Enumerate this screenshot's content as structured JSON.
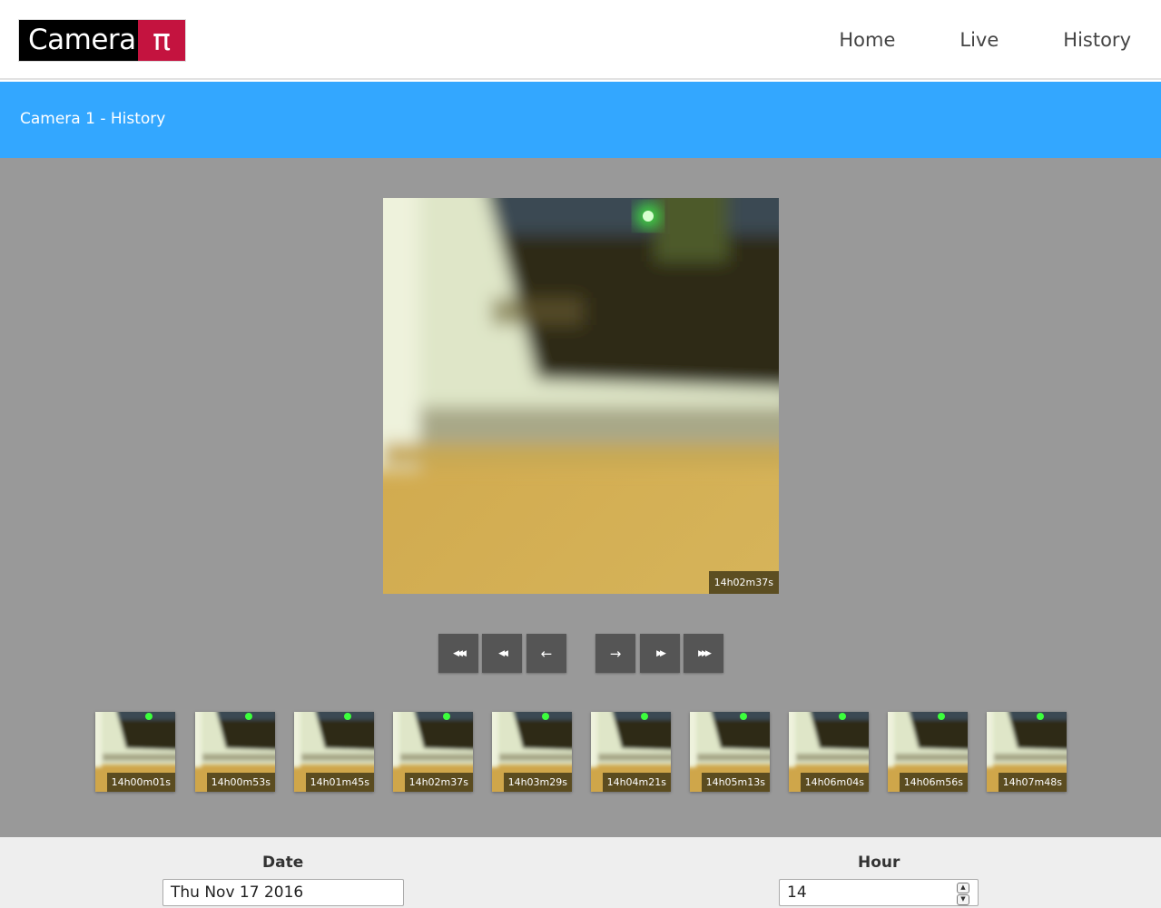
{
  "header": {
    "logo_text": "Camera",
    "logo_symbol": "π",
    "nav": [
      {
        "label": "Home"
      },
      {
        "label": "Live"
      },
      {
        "label": "History"
      }
    ]
  },
  "page_title": "Camera 1 - History",
  "viewer": {
    "current_time": "14h02m37s",
    "controls": [
      {
        "name": "first-button",
        "glyph": "◀◀◀",
        "icon": "triple-left-arrow-icon"
      },
      {
        "name": "fast-back-button",
        "glyph": "◀◀",
        "icon": "double-left-arrow-icon"
      },
      {
        "name": "prev-button",
        "glyph": "←",
        "icon": "left-arrow-icon"
      },
      {
        "name": "next-button",
        "glyph": "→",
        "icon": "right-arrow-icon"
      },
      {
        "name": "fast-forward-button",
        "glyph": "▶▶",
        "icon": "double-right-arrow-icon"
      },
      {
        "name": "last-button",
        "glyph": "▶▶▶",
        "icon": "triple-right-arrow-icon"
      }
    ]
  },
  "thumbnails": [
    {
      "time": "14h00m01s"
    },
    {
      "time": "14h00m53s"
    },
    {
      "time": "14h01m45s"
    },
    {
      "time": "14h02m37s"
    },
    {
      "time": "14h03m29s"
    },
    {
      "time": "14h04m21s"
    },
    {
      "time": "14h05m13s"
    },
    {
      "time": "14h06m04s"
    },
    {
      "time": "14h06m56s"
    },
    {
      "time": "14h07m48s"
    }
  ],
  "form": {
    "date_label": "Date",
    "date_value": "Thu Nov 17 2016",
    "hour_label": "Hour",
    "hour_value": "14"
  },
  "colors": {
    "accent_band": "#33a7ff",
    "logo_red": "#c4133f",
    "stage_gray": "#999999",
    "button_gray": "#555555"
  }
}
